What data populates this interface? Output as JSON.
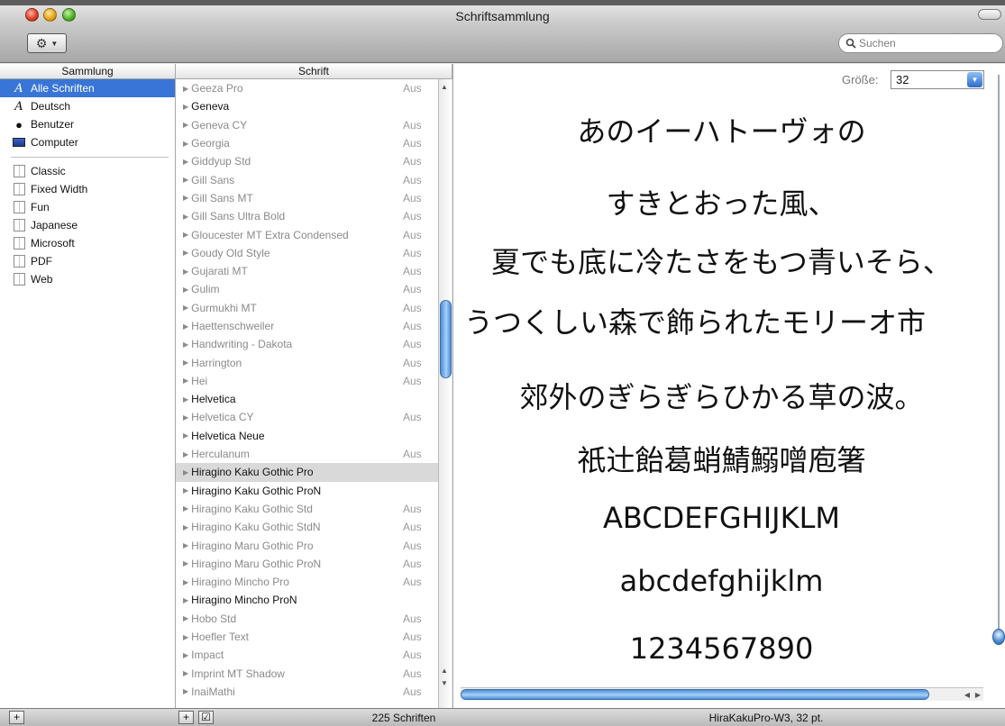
{
  "window": {
    "title": "Schriftsammlung"
  },
  "toolbar": {
    "gear_icon": "gear-icon",
    "search_placeholder": "Suchen"
  },
  "columns": {
    "collection": "Sammlung",
    "font": "Schrift"
  },
  "sidebar": {
    "items": [
      {
        "label": "Alle Schriften",
        "icon": "font-A-icon",
        "selected": true
      },
      {
        "label": "Deutsch",
        "icon": "font-A-icon"
      },
      {
        "label": "Benutzer",
        "icon": "user-icon"
      },
      {
        "label": "Computer",
        "icon": "computer-icon"
      }
    ],
    "collections": [
      "Classic",
      "Fixed Width",
      "Fun",
      "Japanese",
      "Microsoft",
      "PDF",
      "Web"
    ]
  },
  "fonts": [
    {
      "name": "Geeza Pro",
      "state": "Aus"
    },
    {
      "name": "Geneva",
      "state": ""
    },
    {
      "name": "Geneva CY",
      "state": "Aus"
    },
    {
      "name": "Georgia",
      "state": "Aus"
    },
    {
      "name": "Giddyup Std",
      "state": "Aus"
    },
    {
      "name": "Gill Sans",
      "state": "Aus"
    },
    {
      "name": "Gill Sans MT",
      "state": "Aus"
    },
    {
      "name": "Gill Sans Ultra Bold",
      "state": "Aus"
    },
    {
      "name": "Gloucester MT Extra Condensed",
      "state": "Aus"
    },
    {
      "name": "Goudy Old Style",
      "state": "Aus"
    },
    {
      "name": "Gujarati MT",
      "state": "Aus"
    },
    {
      "name": "Gulim",
      "state": "Aus"
    },
    {
      "name": "Gurmukhi MT",
      "state": "Aus"
    },
    {
      "name": "Haettenschweiler",
      "state": "Aus"
    },
    {
      "name": "Handwriting - Dakota",
      "state": "Aus"
    },
    {
      "name": "Harrington",
      "state": "Aus"
    },
    {
      "name": "Hei",
      "state": "Aus"
    },
    {
      "name": "Helvetica",
      "state": ""
    },
    {
      "name": "Helvetica CY",
      "state": "Aus"
    },
    {
      "name": "Helvetica Neue",
      "state": ""
    },
    {
      "name": "Herculanum",
      "state": "Aus"
    },
    {
      "name": "Hiragino Kaku Gothic Pro",
      "state": "",
      "selected": true
    },
    {
      "name": "Hiragino Kaku Gothic ProN",
      "state": ""
    },
    {
      "name": "Hiragino Kaku Gothic Std",
      "state": "Aus"
    },
    {
      "name": "Hiragino Kaku Gothic StdN",
      "state": "Aus"
    },
    {
      "name": "Hiragino Maru Gothic Pro",
      "state": "Aus"
    },
    {
      "name": "Hiragino Maru Gothic ProN",
      "state": "Aus"
    },
    {
      "name": "Hiragino Mincho Pro",
      "state": "Aus"
    },
    {
      "name": "Hiragino Mincho ProN",
      "state": ""
    },
    {
      "name": "Hobo Std",
      "state": "Aus"
    },
    {
      "name": "Hoefler Text",
      "state": "Aus"
    },
    {
      "name": "Impact",
      "state": "Aus"
    },
    {
      "name": "Imprint MT Shadow",
      "state": "Aus"
    },
    {
      "name": "InaiMathi",
      "state": "Aus"
    }
  ],
  "preview": {
    "size_label": "Größe:",
    "size_value": "32",
    "lines": [
      "あのイーハトーヴォの",
      "すきとおった風、",
      "夏でも底に冷たさをもつ青いそら、",
      "うつくしい森で飾られたモリーオ市",
      "郊外のぎらぎらひかる草の波。",
      "祇辻飴葛蛸鯖鰯噌庖箸",
      "ABCDEFGHIJKLM",
      "abcdefghijklm",
      "1234567890"
    ]
  },
  "footer": {
    "add_label": "+",
    "count_text": "225 Schriften",
    "font_info": "HiraKakuPro-W3, 32 pt."
  },
  "colors": {
    "selection": "#3875d7",
    "scroll_thumb": "#4c8ed4"
  }
}
